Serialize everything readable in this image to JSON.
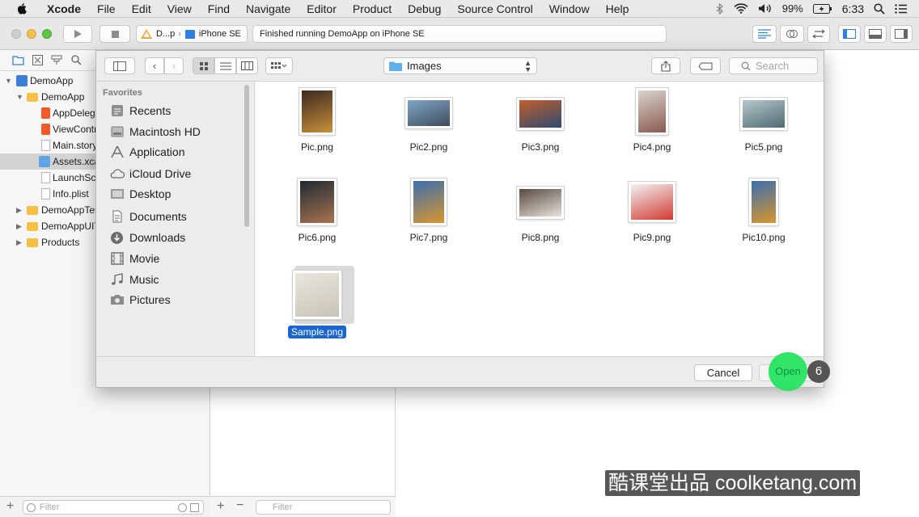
{
  "menubar": {
    "app_name": "Xcode",
    "items": [
      "File",
      "Edit",
      "View",
      "Find",
      "Navigate",
      "Editor",
      "Product",
      "Debug",
      "Source Control",
      "Window",
      "Help"
    ],
    "battery": "99%",
    "time": "6:33"
  },
  "toolbar": {
    "scheme": "D...p",
    "device": "iPhone SE",
    "activity": "Finished running DemoApp on iPhone SE"
  },
  "navigator": {
    "tree": [
      {
        "label": "DemoApp",
        "depth": 0,
        "kind": "project",
        "expanded": true
      },
      {
        "label": "DemoApp",
        "depth": 1,
        "kind": "folder",
        "expanded": true
      },
      {
        "label": "AppDelegate.swift",
        "depth": 2,
        "kind": "swift"
      },
      {
        "label": "ViewController.swift",
        "depth": 2,
        "kind": "swift"
      },
      {
        "label": "Main.storyboard",
        "depth": 2,
        "kind": "file"
      },
      {
        "label": "Assets.xcassets",
        "depth": 2,
        "kind": "assets",
        "selected": true
      },
      {
        "label": "LaunchScreen.storyboard",
        "depth": 2,
        "kind": "file"
      },
      {
        "label": "Info.plist",
        "depth": 2,
        "kind": "file"
      },
      {
        "label": "DemoAppTests",
        "depth": 1,
        "kind": "folder",
        "expanded": false
      },
      {
        "label": "DemoAppUITests",
        "depth": 1,
        "kind": "folder",
        "expanded": false
      },
      {
        "label": "Products",
        "depth": 1,
        "kind": "folder",
        "expanded": false
      }
    ],
    "filter_placeholder": "Filter"
  },
  "assetlist": {
    "filter_placeholder": "Filter"
  },
  "dialog": {
    "location": "Images",
    "search_placeholder": "Search",
    "sidebar_heading": "Favorites",
    "sidebar_items": [
      {
        "label": "Recents",
        "icon": "recents-icon"
      },
      {
        "label": "Macintosh HD",
        "icon": "hard-drive-icon"
      },
      {
        "label": "Application",
        "icon": "applications-icon"
      },
      {
        "label": "iCloud Drive",
        "icon": "cloud-icon"
      },
      {
        "label": "Desktop",
        "icon": "desktop-icon"
      },
      {
        "label": "Documents",
        "icon": "documents-icon"
      },
      {
        "label": "Downloads",
        "icon": "downloads-icon"
      },
      {
        "label": "Movie",
        "icon": "movie-icon"
      },
      {
        "label": "Music",
        "icon": "music-icon"
      },
      {
        "label": "Pictures",
        "icon": "camera-icon"
      }
    ],
    "files": [
      {
        "name": "Pic.png",
        "colors": [
          "#3b2a1e",
          "#c98f3a"
        ],
        "orientation": "portrait"
      },
      {
        "name": "Pic2.png",
        "colors": [
          "#7fa7c9",
          "#3f4b58"
        ],
        "orientation": "landscape"
      },
      {
        "name": "Pic3.png",
        "colors": [
          "#c2602b",
          "#2c4a73"
        ],
        "orientation": "landscape"
      },
      {
        "name": "Pic4.png",
        "colors": [
          "#d9d3cf",
          "#8a5a4f"
        ],
        "orientation": "portrait"
      },
      {
        "name": "Pic5.png",
        "colors": [
          "#b9c7cc",
          "#4c6a73"
        ],
        "orientation": "landscape"
      },
      {
        "name": "Pic6.png",
        "colors": [
          "#1f2a33",
          "#a8744f"
        ],
        "orientation": "square"
      },
      {
        "name": "Pic7.png",
        "colors": [
          "#3a6fb0",
          "#d9962c"
        ],
        "orientation": "portrait"
      },
      {
        "name": "Pic8.png",
        "colors": [
          "#5a4a3f",
          "#e7e2dc"
        ],
        "orientation": "landscape"
      },
      {
        "name": "Pic9.png",
        "colors": [
          "#f2f2f2",
          "#d23a32"
        ],
        "orientation": "square"
      },
      {
        "name": "Pic10.png",
        "colors": [
          "#3a6fb0",
          "#d9962c"
        ],
        "orientation": "portrait"
      },
      {
        "name": "Sample.png",
        "colors": [
          "#e8e6df",
          "#c9c4b4"
        ],
        "orientation": "square",
        "selected": true
      }
    ],
    "cancel_label": "Cancel",
    "open_label": "Open"
  },
  "overlay": {
    "step_number": "6",
    "watermark": "酷课堂出品 coolketang.com"
  }
}
